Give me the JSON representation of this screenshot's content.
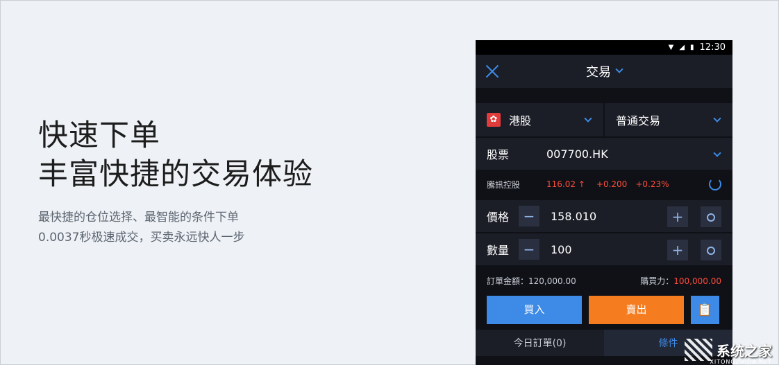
{
  "hero": {
    "headline_1": "快速下单",
    "headline_2": "丰富快捷的交易体验",
    "desc_1": "最快捷的仓位选择、最智能的条件下单",
    "desc_2": "0.0037秒极速成交，买卖永远快人一步"
  },
  "phone": {
    "status_time": "12:30",
    "title": "交易",
    "market": "港股",
    "order_type": "普通交易",
    "stock_label": "股票",
    "stock_code": "007700.HK",
    "quote": {
      "name": "騰訊控股",
      "price": "116.02",
      "arrow": "↑",
      "change": "+0.200",
      "change_pct": "+0.23%"
    },
    "price_label": "價格",
    "price_value": "158.010",
    "qty_label": "數量",
    "qty_value": "100",
    "minus": "−",
    "plus": "+",
    "order_amount": "訂單金額：120,000.00",
    "buying_power_label": "購買力：",
    "buying_power_value": "100,000.00",
    "buy_label": "買入",
    "sell_label": "賣出",
    "clip_icon": "📋",
    "tab_today": "今日訂單(0)",
    "tab_conditional": "條件"
  },
  "watermark": {
    "text": "系统之家",
    "url": "XITONGZHIJIA.NET"
  },
  "colors": {
    "accent": "#3d8be6",
    "sell": "#f57c1f",
    "up": "#ff4d3a"
  }
}
